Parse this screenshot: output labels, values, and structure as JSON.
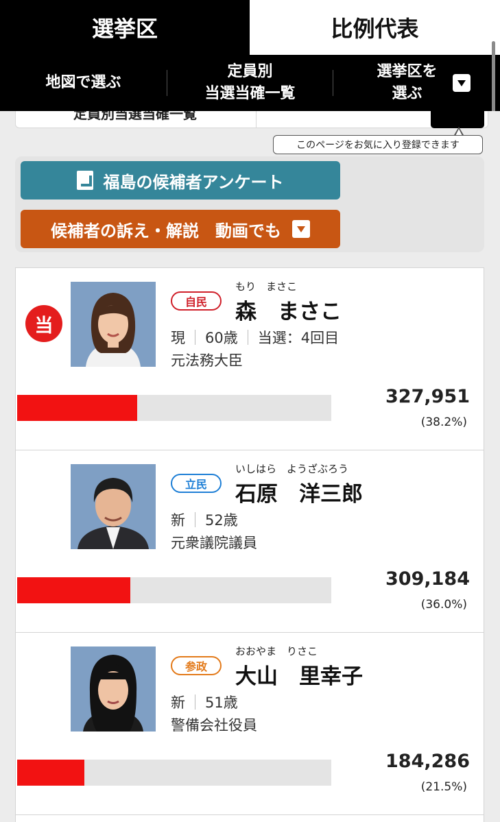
{
  "tabs": {
    "active": "選挙区",
    "inactive": "比例代表"
  },
  "sub_nav": {
    "map": "地図で選ぶ",
    "by_seat_line1": "定員別",
    "by_seat_line2": "当選当確一覧",
    "choose_line1": "選挙区を",
    "choose_line2": "選ぶ"
  },
  "peek": {
    "text": "定員別当選当確一覧"
  },
  "tooltip": "このページをお気に入り登録できます",
  "buttons": {
    "survey": "福島の候補者アンケート",
    "video": "候補者の訴え・解説　動画でも"
  },
  "accent_colors": {
    "win": "#e41d1d",
    "bar": "#f21212",
    "survey_button": "#35869a",
    "video_button": "#c85613"
  },
  "candidates": [
    {
      "elected_mark": "当",
      "party": "自民",
      "party_color": "#d0202a",
      "furigana": "もり　まさこ",
      "name": "森　まさこ",
      "status": "現",
      "age": "60歳",
      "wins": "当選：4回目",
      "title": "元法務大臣",
      "votes": "327,951",
      "percent": "(38.2%)",
      "share": 38.2
    },
    {
      "elected_mark": "",
      "party": "立民",
      "party_color": "#1e7fd6",
      "furigana": "いしはら　ようざぶろう",
      "name": "石原　洋三郎",
      "status": "新",
      "age": "52歳",
      "wins": "",
      "title": "元衆議院議員",
      "votes": "309,184",
      "percent": "(36.0%)",
      "share": 36.0
    },
    {
      "elected_mark": "",
      "party": "参政",
      "party_color": "#e37a1a",
      "furigana": "おおやま　りさこ",
      "name": "大山　里幸子",
      "status": "新",
      "age": "51歳",
      "wins": "",
      "title": "警備会社役員",
      "votes": "184,286",
      "percent": "(21.5%)",
      "share": 21.5
    }
  ]
}
